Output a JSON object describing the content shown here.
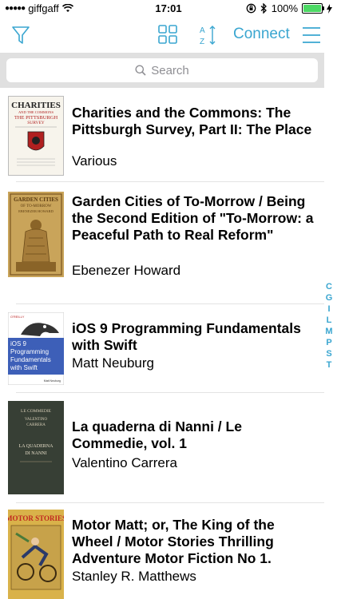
{
  "status_bar": {
    "carrier": "giffgaff",
    "time": "17:01",
    "battery": "100%"
  },
  "toolbar": {
    "connect_label": "Connect"
  },
  "search": {
    "placeholder": "Search"
  },
  "books": [
    {
      "title": "Charities and the Commons: The Pittsburgh Survey, Part II: The Place",
      "author": "Various"
    },
    {
      "title": "Garden Cities of To-Morrow / Being the Second Edition of \"To-Morrow: a Peaceful Path to Real Reform\"",
      "author": "Ebenezer Howard"
    },
    {
      "title": "iOS 9 Programming Fundamentals with Swift",
      "author": "Matt Neuburg"
    },
    {
      "title": "La quaderna di Nanni / Le Commedie, vol. 1",
      "author": "Valentino Carrera"
    },
    {
      "title": "Motor Matt; or, The King of the Wheel / Motor Stories Thrilling Adventure Motor Fiction No 1.",
      "author": "Stanley R. Matthews"
    }
  ],
  "covers": {
    "charities": {
      "line1": "CHARITIES",
      "line2": "AND THE COMMONS",
      "line3": "THE PITTSBURGH",
      "line4": "SURVEY"
    },
    "garden": {
      "line1": "GARDEN CITIES",
      "line2": "OF TO-MORROW",
      "line3": "EBENEZER HOWARD"
    },
    "ios": {
      "publisher": "O'REILLY",
      "line1": "iOS 9",
      "line2": "Programming",
      "line3": "Fundamentals",
      "line4": "with Swift",
      "author": "Matt Neuburg"
    },
    "quaderna": {
      "line1": "LE COMMEDIE",
      "line2": "VALENTINO",
      "line3": "CARRERA",
      "line4": "LA QUADERNA",
      "line5": "DI NANNI"
    },
    "motor": {
      "line1": "MOTOR STORIES"
    }
  },
  "index_letters": [
    "C",
    "G",
    "I",
    "L",
    "M",
    "P",
    "S",
    "T"
  ],
  "colors": {
    "accent": "#3aa6d0",
    "battery": "#4cd964",
    "search_bg": "#e0e0e0"
  }
}
